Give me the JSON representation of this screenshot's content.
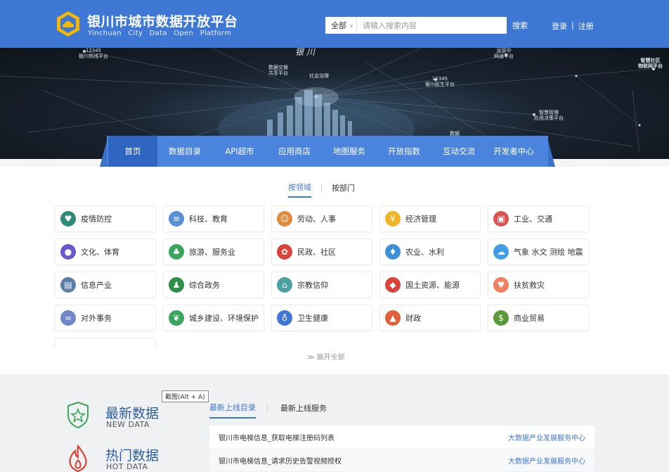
{
  "header": {
    "title_cn": "银川市城市数据开放平台",
    "title_en": "Yinchuan City Data Open Platform",
    "search": {
      "scope": "全部",
      "placeholder": "请输入搜索内容",
      "button": "搜索"
    },
    "login": "登录",
    "divider": "|",
    "register": "注册"
  },
  "banner": {
    "city": "银 川",
    "labels": [
      "12345\n银川热线平台",
      "12345\n银川民生平台",
      "运营中\n网通平台",
      "智慧社区\n物联网平台",
      "数据交换\n共享平台",
      "社会治理",
      "智慧管理\n应用决策平台",
      "数据\n交换"
    ]
  },
  "nav": [
    "首页",
    "数据目录",
    "API超市",
    "应用商店",
    "地图服务",
    "开放指数",
    "互动交流",
    "开发者中心"
  ],
  "main": {
    "tabs": [
      "按领域",
      "按部门"
    ],
    "categories": [
      {
        "label": "疫情防控",
        "icon": "mask-icon",
        "color": "#2e8b7a",
        "glyph": "♥"
      },
      {
        "label": "科技、教育",
        "icon": "books-icon",
        "color": "#5b8fd6",
        "glyph": "≡"
      },
      {
        "label": "劳动、人事",
        "icon": "people-icon",
        "color": "#e08a3c",
        "glyph": "☺"
      },
      {
        "label": "经济管理",
        "icon": "coin-icon",
        "color": "#f0b429",
        "glyph": "¥"
      },
      {
        "label": "工业、交通",
        "icon": "train-icon",
        "color": "#d9534f",
        "glyph": "▣"
      },
      {
        "label": "文化、体育",
        "icon": "ball-icon",
        "color": "#6a5acd",
        "glyph": "●"
      },
      {
        "label": "旅游、服务业",
        "icon": "palm-icon",
        "color": "#3aa55c",
        "glyph": "♣"
      },
      {
        "label": "民政、社区",
        "icon": "badge-icon",
        "color": "#d9433a",
        "glyph": "✿"
      },
      {
        "label": "农业、水利",
        "icon": "drop-icon",
        "color": "#3c8fd9",
        "glyph": "♦"
      },
      {
        "label": "气象 水文 测绘 地震",
        "icon": "cloud-icon",
        "color": "#3f9ee6",
        "glyph": "☁"
      },
      {
        "label": "信息产业",
        "icon": "server-icon",
        "color": "#5d7ea8",
        "glyph": "▤"
      },
      {
        "label": "综合政务",
        "icon": "stamp-icon",
        "color": "#2f8f4a",
        "glyph": "♟"
      },
      {
        "label": "宗教信仰",
        "icon": "temple-icon",
        "color": "#4aa3a0",
        "glyph": "⌂"
      },
      {
        "label": "国土资源、能源",
        "icon": "map-icon",
        "color": "#d9433a",
        "glyph": "◆"
      },
      {
        "label": "扶贫救灾",
        "icon": "heart-hand-icon",
        "color": "#f08060",
        "glyph": "♥"
      },
      {
        "label": "对外事务",
        "icon": "handshake-icon",
        "color": "#6f86c9",
        "glyph": "∞"
      },
      {
        "label": "城乡建设、环境保护",
        "icon": "leaf-icon",
        "color": "#3aa55c",
        "glyph": "❦"
      },
      {
        "label": "卫生健康",
        "icon": "stethoscope-icon",
        "color": "#3f78d4",
        "glyph": "♁"
      },
      {
        "label": "财政",
        "icon": "chart-up-icon",
        "color": "#e0603a",
        "glyph": "▲"
      },
      {
        "label": "商业贸易",
        "icon": "moneybag-icon",
        "color": "#5a9a3a",
        "glyph": "$"
      }
    ],
    "expand": "展开全部"
  },
  "bottom": {
    "tooltip": "截图(Alt + A)",
    "new_title": "最新数据",
    "new_sub": "NEW DATA",
    "hot_title": "热门数据",
    "hot_sub": "HOT DATA",
    "tabs": [
      "最新上线目录",
      "最新上线服务"
    ],
    "rows": [
      {
        "title": "银川市电梯信息_获取电梯注册码列表",
        "source": "大数据产业发展服务中心"
      },
      {
        "title": "银川市电梯信息_请求历史告警视频授权",
        "source": "大数据产业发展服务中心"
      }
    ]
  },
  "colors": {
    "header": "#3f78d4",
    "nav": "#4a84dc",
    "nav_active": "#2f66c2",
    "accent": "#3f78d4",
    "section_title": "#2f5f9c"
  }
}
